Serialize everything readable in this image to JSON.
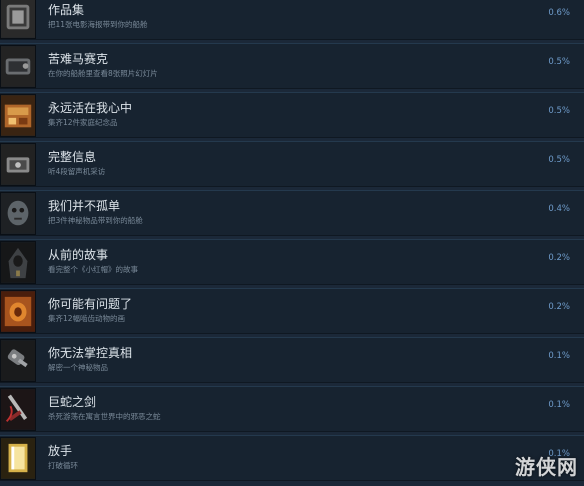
{
  "achievements": [
    {
      "title": "作品集",
      "desc": "把11张电影海报带到你的船舱",
      "percent": "0.6%",
      "icon": "film-reel-icon",
      "accent": "#6a6a6a"
    },
    {
      "title": "苦难马赛克",
      "desc": "在你的船舱里查看8张照片幻灯片",
      "percent": "0.5%",
      "icon": "slide-projector-icon",
      "accent": "#555a60"
    },
    {
      "title": "永远活在我心中",
      "desc": "集齐12件家庭纪念品",
      "percent": "0.5%",
      "icon": "memento-box-icon",
      "accent": "#b06a2a"
    },
    {
      "title": "完整信息",
      "desc": "听4段留声机采访",
      "percent": "0.5%",
      "icon": "phonograph-icon",
      "accent": "#6e6e6e"
    },
    {
      "title": "我们并不孤单",
      "desc": "把3件神秘物品带到你的船舱",
      "percent": "0.4%",
      "icon": "mysterious-mask-icon",
      "accent": "#4a5055"
    },
    {
      "title": "从前的故事",
      "desc": "看完整个《小红帽》的故事",
      "percent": "0.2%",
      "icon": "hooded-figure-icon",
      "accent": "#3a3c3e"
    },
    {
      "title": "你可能有问题了",
      "desc": "集齐12幅啮齿动物的画",
      "percent": "0.2%",
      "icon": "rodent-painting-icon",
      "accent": "#a8541e"
    },
    {
      "title": "你无法掌控真相",
      "desc": "解密一个神秘物品",
      "percent": "0.1%",
      "icon": "drill-gadget-icon",
      "accent": "#5d5f62"
    },
    {
      "title": "巨蛇之剑",
      "desc": "杀死游荡在寓言世界中的邪恶之蛇",
      "percent": "0.1%",
      "icon": "serpent-sword-icon",
      "accent": "#8a2a2a"
    },
    {
      "title": "放手",
      "desc": "打破循环",
      "percent": "0.1%",
      "icon": "glowing-book-icon",
      "accent": "#d6b24a"
    }
  ],
  "watermark": "游侠网"
}
